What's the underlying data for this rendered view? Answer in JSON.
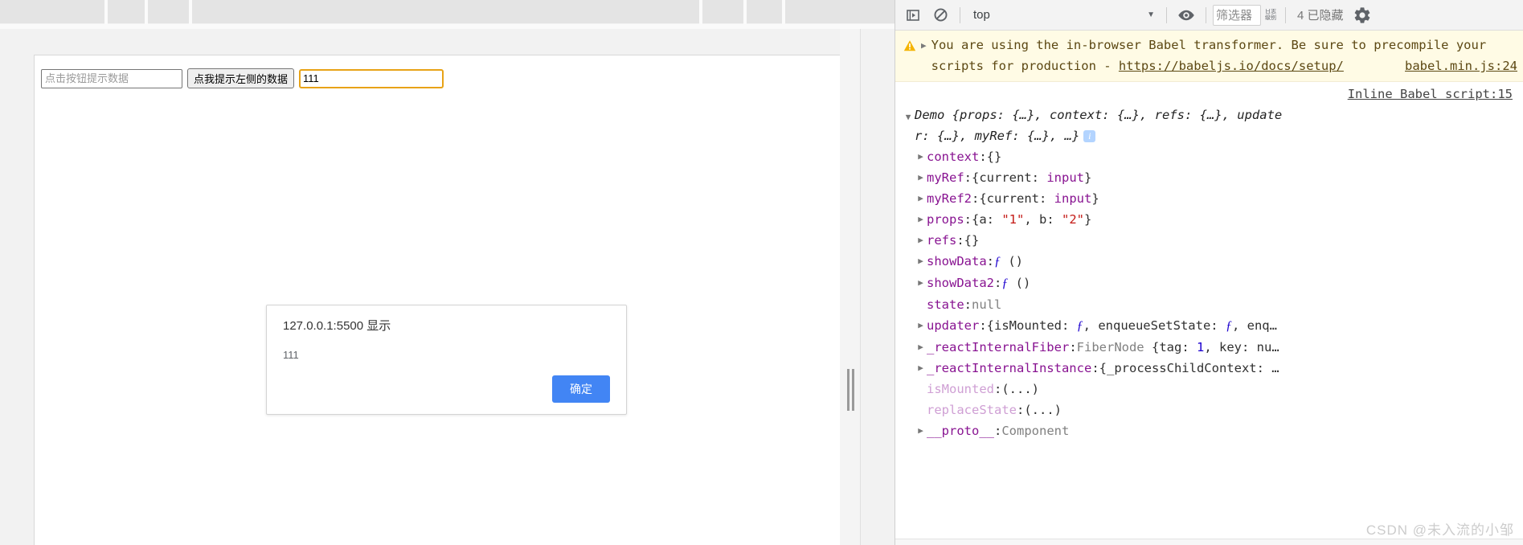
{
  "page": {
    "input_placeholder": "点击按钮提示数据",
    "button_label": "点我提示左侧的数据",
    "input_value": "111"
  },
  "dialog": {
    "origin": "127.0.0.1:5500 显示",
    "message": "111",
    "ok_label": "确定",
    "accent_color": "#4285f4"
  },
  "devtools": {
    "toolbar": {
      "sidebar_icon": "console-sidebar-icon",
      "clear_icon": "clear-console-icon",
      "context_value": "top",
      "caret_icon": "chevron-down-icon",
      "eye_icon": "live-expression-eye-icon",
      "filter_placeholder": "筛选器",
      "levels_label": "日志级别",
      "hidden_label": "4 已隐藏",
      "gear_icon": "settings-gear-icon"
    },
    "warning": {
      "icon": "warning-triangle-icon",
      "arrow_icon": "expand-arrow-icon",
      "text": "You are using the in-browser Babel transformer. Be sure to precompile your scripts for production - ",
      "link": "https://babeljs.io/docs/setup/",
      "source": "babel.min.js:24",
      "background": "#fffbe5",
      "text_color": "#5c4813"
    },
    "log": {
      "source": "Inline Babel script:15",
      "object_preview_line1": "Demo {props: {…}, context: {…}, refs: {…}, update",
      "object_preview_line2": "r: {…}, myRef: {…}, …}",
      "info_badge": "i",
      "properties": [
        {
          "expandable": true,
          "name": "context",
          "value_html": "{}"
        },
        {
          "expandable": true,
          "name": "myRef",
          "value_html": "{current: <span class=\"ref\">input</span>}"
        },
        {
          "expandable": true,
          "name": "myRef2",
          "value_html": "{current: <span class=\"ref\">input</span>}"
        },
        {
          "expandable": true,
          "name": "props",
          "value_html": "{a: <span class=\"str\">\"1\"</span>, b: <span class=\"str\">\"2\"</span>}"
        },
        {
          "expandable": true,
          "name": "refs",
          "value_html": "{}"
        },
        {
          "expandable": true,
          "name": "showData",
          "value_html": "<span class=\"fn\">ƒ</span> ()"
        },
        {
          "expandable": true,
          "name": "showData2",
          "value_html": "<span class=\"fn\">ƒ</span> ()"
        },
        {
          "expandable": false,
          "name": "state",
          "value_html": "<span class=\"nul\">null</span>"
        },
        {
          "expandable": true,
          "name": "updater",
          "value_html": "{isMounted: <span class=\"fn\">ƒ</span>, enqueueSetState: <span class=\"fn\">ƒ</span>, enq…"
        },
        {
          "expandable": true,
          "name": "_reactInternalFiber",
          "value_html": "<span class=\"cls\">FiberNode</span> {tag: <span class=\"num\">1</span>, key: nu…"
        },
        {
          "expandable": true,
          "name": "_reactInternalInstance",
          "value_html": "{_processChildContext: …"
        },
        {
          "expandable": false,
          "name": "isMounted",
          "getter": true,
          "value_html": "(...)"
        },
        {
          "expandable": false,
          "name": "replaceState",
          "getter": true,
          "value_html": "(...)"
        },
        {
          "expandable": true,
          "name": "__proto__",
          "value_html": "<span class=\"cls\">Component</span>"
        }
      ]
    }
  },
  "watermark": "CSDN @未入流的小邹"
}
